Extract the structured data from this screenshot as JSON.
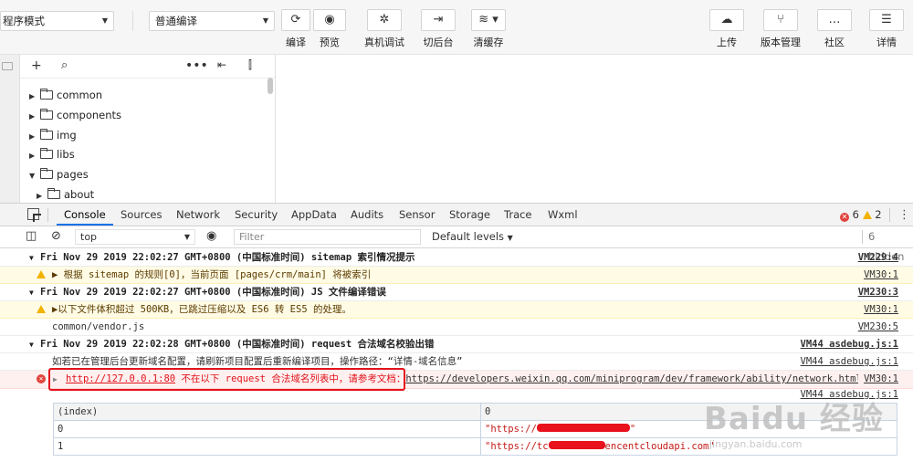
{
  "toolbar": {
    "mode_select": "程序模式",
    "compile_select": "普通编译",
    "buttons": [
      {
        "label": "编译",
        "icon": "refresh-icon"
      },
      {
        "label": "预览",
        "icon": "eye-icon"
      },
      {
        "label": "真机调试",
        "icon": "bug-icon"
      },
      {
        "label": "切后台",
        "icon": "switch-icon"
      },
      {
        "label": "清缓存",
        "icon": "layers-icon"
      },
      {
        "label": "上传",
        "icon": "cloud-upload-icon"
      },
      {
        "label": "版本管理",
        "icon": "branch-icon"
      },
      {
        "label": "社区",
        "icon": "chat-icon"
      },
      {
        "label": "详情",
        "icon": "menu-icon"
      }
    ]
  },
  "tree": {
    "items": [
      {
        "name": "common",
        "expanded": false,
        "depth": 0
      },
      {
        "name": "components",
        "expanded": false,
        "depth": 0
      },
      {
        "name": "img",
        "expanded": false,
        "depth": 0
      },
      {
        "name": "libs",
        "expanded": false,
        "depth": 0
      },
      {
        "name": "pages",
        "expanded": true,
        "depth": 0
      },
      {
        "name": "about",
        "expanded": false,
        "depth": 1
      }
    ]
  },
  "devtools": {
    "tabs": [
      "Console",
      "Sources",
      "Network",
      "Security",
      "AppData",
      "Audits",
      "Sensor",
      "Storage",
      "Trace",
      "Wxml"
    ],
    "active_tab": "Console",
    "error_count": "6",
    "warning_count": "2",
    "context": "top",
    "filter_placeholder": "Filter",
    "levels": "Default levels",
    "hidden": "6 hidden"
  },
  "console": {
    "g1": {
      "text": "Fri Nov 29 2019 22:02:27 GMT+0800 (中国标准时间) sitemap 索引情况提示",
      "src": "VM229:4"
    },
    "w1": {
      "text": "▶ 根据 sitemap 的规则[0]，当前页面 [pages/crm/main] 将被索引",
      "src": "VM30:1"
    },
    "g2": {
      "text": "Fri Nov 29 2019 22:02:27 GMT+0800 (中国标准时间) JS 文件编译错误",
      "src": "VM230:3"
    },
    "w2": {
      "text": "▶以下文件体积超过 500KB，已跳过压缩以及 ES6 转 ES5 的处理。",
      "src": "VM30:1"
    },
    "l1": {
      "text": "common/vendor.js",
      "src": "VM230:5"
    },
    "g3": {
      "text": "Fri Nov 29 2019 22:02:28 GMT+0800 (中国标准时间) request 合法域名校验出错",
      "src": "VM44 asdebug.js:1"
    },
    "l2": {
      "text": "如若已在管理后台更新域名配置，请刷新项目配置后重新编译项目，操作路径：“详情-域名信息”",
      "src": "VM44 asdebug.js:1"
    },
    "e1": {
      "url": "http://127.0.0.1:80",
      "text": " 不在以下 request 合法域名列表中，请参考文档：",
      "link": "https://developers.weixin.qq.com/miniprogram/dev/framework/ability/network.html",
      "src": "VM30:1"
    },
    "l3": {
      "src": "VM44 asdebug.js:1"
    },
    "table": {
      "headers": [
        "(index)",
        "0"
      ],
      "rows": [
        {
          "index": "0",
          "prefix": "\"https://",
          "suffix": "\""
        },
        {
          "index": "1",
          "prefix": "\"https://tc",
          "suffix": "encentcloudapi.com\""
        }
      ]
    }
  },
  "watermark": {
    "brand": "Baidu 经验",
    "url": "jingyan.baidu.com"
  }
}
